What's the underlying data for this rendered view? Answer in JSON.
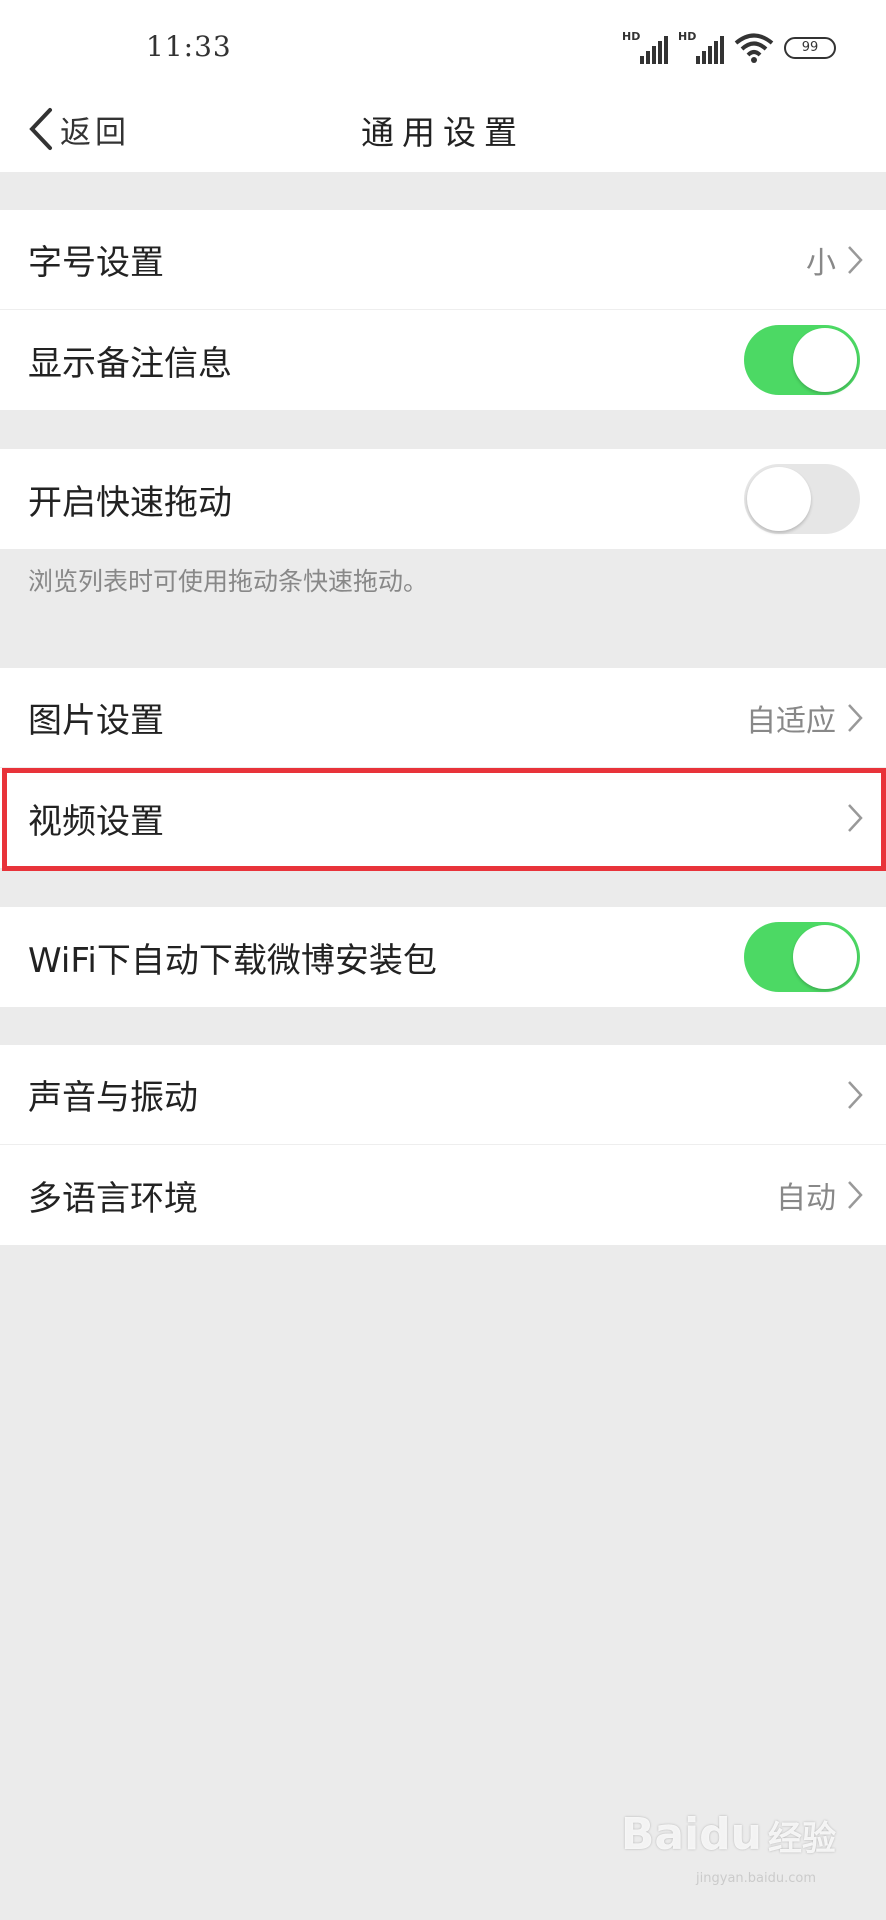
{
  "status_bar": {
    "time": "11:33",
    "sim1_label": "HD",
    "sim2_label": "HD",
    "battery": "99"
  },
  "header": {
    "back_label": "返回",
    "title": "通用设置"
  },
  "groups": [
    {
      "rows": [
        {
          "label": "字号设置",
          "value": "小",
          "chevron": true
        },
        {
          "label": "显示备注信息",
          "toggle": true
        }
      ]
    },
    {
      "rows": [
        {
          "label": "开启快速拖动",
          "toggle": false
        }
      ],
      "footer": "浏览列表时可使用拖动条快速拖动。"
    },
    {
      "rows": [
        {
          "label": "图片设置",
          "value": "自适应",
          "chevron": true
        },
        {
          "label": "视频设置",
          "chevron": true,
          "highlighted": true
        }
      ]
    },
    {
      "rows": [
        {
          "label": "WiFi下自动下载微博安装包",
          "toggle": true
        }
      ]
    },
    {
      "rows": [
        {
          "label": "声音与振动",
          "chevron": true
        },
        {
          "label": "多语言环境",
          "value": "自动",
          "chevron": true
        }
      ]
    }
  ],
  "colors": {
    "toggle_on": "#4cd964",
    "highlight": "#e8333a"
  },
  "watermark": {
    "brand": "Baidu",
    "cn": "经验",
    "sub": "jingyan.baidu.com"
  }
}
